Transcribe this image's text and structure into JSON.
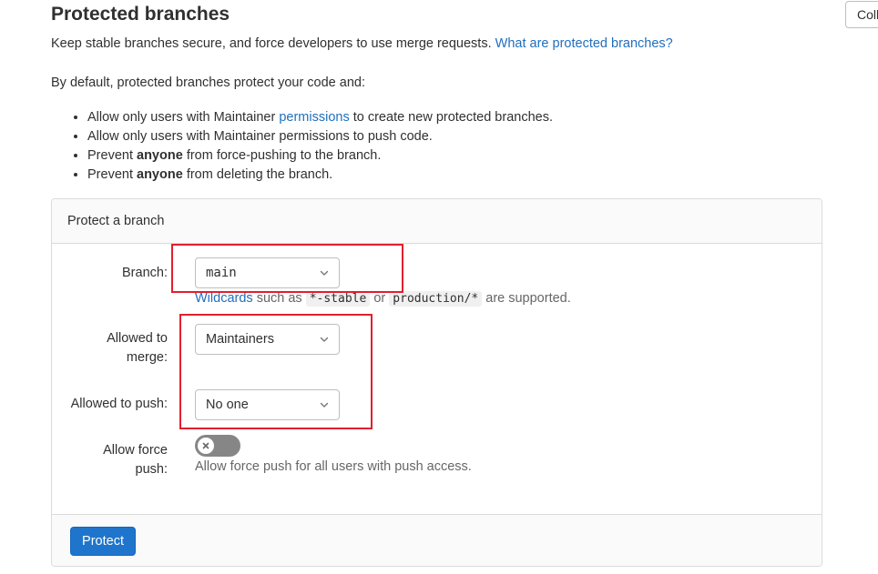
{
  "header": {
    "title": "Protected branches",
    "collapse_label": "Coll"
  },
  "intro": {
    "text": "Keep stable branches secure, and force developers to use merge requests.",
    "link": "What are protected branches?"
  },
  "defaults": {
    "lead": "By default, protected branches protect your code and:",
    "rule1_pre": "Allow only users with Maintainer",
    "rule1_link": "permissions",
    "rule1_post": "to create new protected branches.",
    "rule2": "Allow only users with Maintainer permissions to push code.",
    "rule3_pre": "Prevent",
    "rule3_bold": "anyone",
    "rule3_post": "from force-pushing to the branch.",
    "rule4_pre": "Prevent",
    "rule4_bold": "anyone",
    "rule4_post": "from deleting the branch."
  },
  "form": {
    "card_title": "Protect a branch",
    "branch_label": "Branch:",
    "branch_value": "main",
    "wildcards_link": "Wildcards",
    "wildcards_such_as": "such as",
    "wildcard_example1": "*-stable",
    "wildcards_or": "or",
    "wildcard_example2": "production/*",
    "wildcards_supported": "are supported.",
    "merge_label_line1": "Allowed to",
    "merge_label_line2": "merge:",
    "merge_value": "Maintainers",
    "push_label": "Allowed to push:",
    "push_value": "No one",
    "force_label_line1": "Allow force",
    "force_label_line2": "push:",
    "force_help": "Allow force push for all users with push access.",
    "force_enabled": false,
    "protect_button": "Protect"
  },
  "colors": {
    "accent": "#1f75cb",
    "link": "#1f6fbd",
    "highlight": "#e0202d"
  },
  "icons": {
    "dropdown": "chevron-down-icon",
    "toggle": "close-icon"
  }
}
